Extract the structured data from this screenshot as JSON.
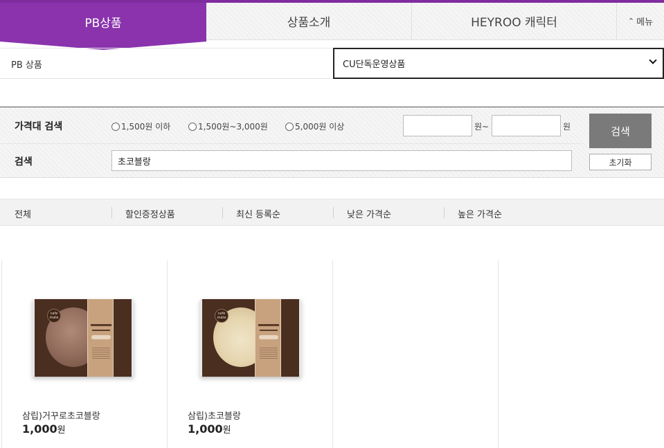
{
  "tabs": {
    "items": [
      {
        "label": "PB상품",
        "active": true
      },
      {
        "label": "상품소개",
        "active": false
      },
      {
        "label": "HEYROO 캐릭터",
        "active": false
      }
    ],
    "menu_label": "메뉴",
    "menu_icon": "chevron-up-icon",
    "accent_color": "#8a33ad"
  },
  "category": {
    "label": "PB 상품",
    "selected": "CU단독운영상품"
  },
  "search": {
    "price_label": "가격대 검색",
    "price_options": [
      "1,500원 이하",
      "1,500원~3,000원",
      "5,000원 이상"
    ],
    "price_from_unit": "원~",
    "price_to_unit": "원",
    "keyword_label": "검색",
    "keyword_value": "초코블랑",
    "search_button": "검색",
    "reset_button": "초기화"
  },
  "sort": {
    "items": [
      "전체",
      "할인증정상품",
      "최신 등록순",
      "낮은 가격순",
      "높은 가격순"
    ]
  },
  "products": [
    {
      "name": "삼립)거꾸로초코블랑",
      "price": "1,000",
      "currency": "원",
      "logo_text": "cafe mate"
    },
    {
      "name": "삼립)초코블랑",
      "price": "1,000",
      "currency": "원",
      "logo_text": "cafe mate"
    }
  ]
}
